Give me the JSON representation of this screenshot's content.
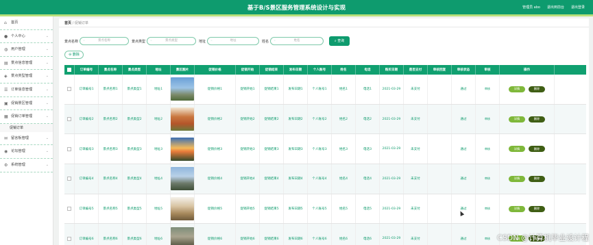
{
  "app": {
    "title": "基于B/S景区服务管理系统设计与实现",
    "user_label": "管理员 abo",
    "links": [
      "退出到前台",
      "退出登录"
    ]
  },
  "sidebar": {
    "items": [
      {
        "label": "首页",
        "icon": "home-icon",
        "has_chevron": false
      },
      {
        "label": "个人中心",
        "icon": "user-icon",
        "has_chevron": true
      },
      {
        "label": "用户管理",
        "icon": "users-icon",
        "has_chevron": true
      },
      {
        "label": "景点信息管理",
        "icon": "building-icon",
        "has_chevron": true
      },
      {
        "label": "景点类型管理",
        "icon": "tag-icon",
        "has_chevron": true
      },
      {
        "label": "订单信息管理",
        "icon": "list-icon",
        "has_chevron": true
      },
      {
        "label": "促销景区管理",
        "icon": "cube-icon",
        "has_chevron": true
      },
      {
        "label": "促销订单管理",
        "icon": "file-icon",
        "has_chevron": true,
        "expanded": true
      },
      {
        "label": "留言板管理",
        "icon": "message-icon",
        "has_chevron": true
      },
      {
        "label": "论坛管理",
        "icon": "forum-icon",
        "has_chevron": true
      },
      {
        "label": "系统管理",
        "icon": "gear-icon",
        "has_chevron": true
      }
    ],
    "submenu": "促销订单"
  },
  "breadcrumb": {
    "home": "首页",
    "sep": "/",
    "current": "促销订单"
  },
  "search": {
    "fields": [
      {
        "label": "景点名称",
        "placeholder": "景点名称"
      },
      {
        "label": "景点类型",
        "placeholder": "景点类型"
      },
      {
        "label": "地址",
        "placeholder": "地址"
      },
      {
        "label": "姓名",
        "placeholder": "姓名"
      }
    ],
    "button": "查询"
  },
  "toolbar": {
    "delete": "删除"
  },
  "table": {
    "headers": [
      "",
      "订单编号",
      "景点名称",
      "景点类型",
      "地址",
      "景区图片",
      "促销价格",
      "促销开始",
      "促销结束",
      "发布日期",
      "个人账号",
      "姓名",
      "电话",
      "购买日期",
      "是否支付",
      "审核回复",
      "审核状态",
      "审核",
      "操作"
    ],
    "rows": [
      {
        "id": "订单编号1",
        "name": "景点名称1",
        "type": "景点类型1",
        "addr": "地址1",
        "price": "促销价格1",
        "start": "促销开始1",
        "end": "促销结束1",
        "pub": "发布日期1",
        "acct": "个人账号1",
        "person": "姓名1",
        "phone": "电话1",
        "date": "2021-03-29",
        "paid": "未支付",
        "reply": "",
        "status": "通过",
        "audit": "审核",
        "img": "tower"
      },
      {
        "id": "订单编号2",
        "name": "景点名称2",
        "type": "景点类型2",
        "addr": "地址2",
        "price": "促销价格2",
        "start": "促销开始2",
        "end": "促销结束2",
        "pub": "发布日期2",
        "acct": "个人账号2",
        "person": "姓名2",
        "phone": "电话2",
        "date": "2021-03-29",
        "paid": "未支付",
        "reply": "",
        "status": "通过",
        "audit": "审核",
        "img": "rock"
      },
      {
        "id": "订单编号3",
        "name": "景点名称3",
        "type": "景点类型3",
        "addr": "地址3",
        "price": "促销价格3",
        "start": "促销开始3",
        "end": "促销结束3",
        "pub": "发布日期3",
        "acct": "个人账号3",
        "person": "姓名3",
        "phone": "电话3",
        "date": "2021-03-29",
        "paid": "未支付",
        "reply": "",
        "status": "通过",
        "audit": "审核",
        "img": "sunset"
      },
      {
        "id": "订单编号4",
        "name": "景点名称4",
        "type": "景点类型4",
        "addr": "地址4",
        "price": "促销价格4",
        "start": "促销开始4",
        "end": "促销结束4",
        "pub": "发布日期4",
        "acct": "个人账号4",
        "person": "姓名4",
        "phone": "电话4",
        "date": "2021-03-29",
        "paid": "未支付",
        "reply": "",
        "status": "通过",
        "audit": "审核",
        "img": "pagoda"
      },
      {
        "id": "订单编号5",
        "name": "景点名称5",
        "type": "景点类型5",
        "addr": "地址5",
        "price": "促销价格5",
        "start": "促销开始5",
        "end": "促销结束5",
        "pub": "发布日期5",
        "acct": "个人账号5",
        "person": "姓名5",
        "phone": "电话5",
        "date": "2021-03-29",
        "paid": "未支付",
        "reply": "",
        "status": "通过",
        "audit": "审核",
        "img": "peak"
      },
      {
        "id": "订单编号6",
        "name": "景点名称6",
        "type": "景点类型6",
        "addr": "地址6",
        "price": "促销价格6",
        "start": "促销开始6",
        "end": "促销结束6",
        "pub": "发布日期6",
        "acct": "个人账号6",
        "person": "姓名6",
        "phone": "电话6",
        "date": "2021-03-29",
        "paid": "未支付",
        "reply": "",
        "status": "通过",
        "audit": "审核",
        "img": "cliff"
      }
    ],
    "row_actions": {
      "edit": "详情",
      "delete": "删除"
    }
  },
  "watermark": "CSDN @计算机毕业设计程",
  "colors": {
    "primary": "#0e9b6e",
    "accent_stripe": "#b8e07a",
    "edit_btn": "#7fb83a",
    "delete_btn": "#3f5e14"
  }
}
